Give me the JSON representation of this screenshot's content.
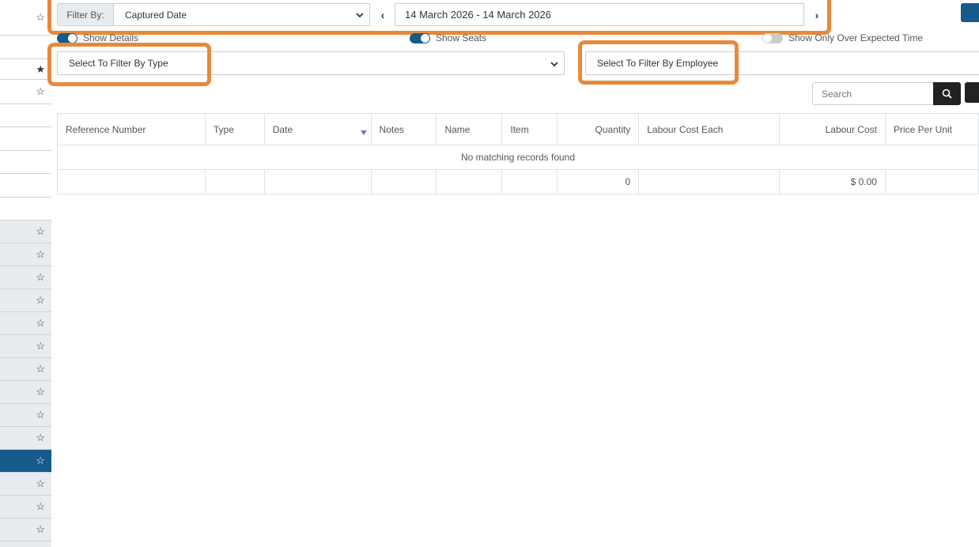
{
  "sidebar": {
    "stars": [
      "☆",
      "★",
      "☆",
      "☆",
      "☆",
      "☆",
      "☆",
      "☆",
      "☆",
      "☆",
      "☆",
      "☆",
      "☆",
      "☆",
      "☆",
      "☆",
      "☆"
    ]
  },
  "filter": {
    "label": "Filter By:",
    "selected": "Captured Date",
    "date_range": "14 March 2026 - 14 March 2026",
    "prev": "‹",
    "next": "›"
  },
  "toggles": {
    "show_details": "Show Details",
    "show_seats": "Show Seats",
    "show_over_expected": "Show Only Over Expected Time"
  },
  "type_filter": {
    "placeholder": "Select To Filter By Type"
  },
  "employee_filter": {
    "placeholder": "Select To Filter By Employee"
  },
  "search": {
    "placeholder": "Search"
  },
  "table": {
    "headers": [
      "Reference Number",
      "Type",
      "Date",
      "Notes",
      "Name",
      "Item",
      "Quantity",
      "Labour Cost Each",
      "Labour Cost",
      "Price Per Unit"
    ],
    "empty_message": "No matching records found",
    "totals": {
      "quantity": "0",
      "labour_cost": "$ 0.00"
    }
  },
  "colors": {
    "accent": "#155a8a",
    "highlight": "#e8893a"
  }
}
